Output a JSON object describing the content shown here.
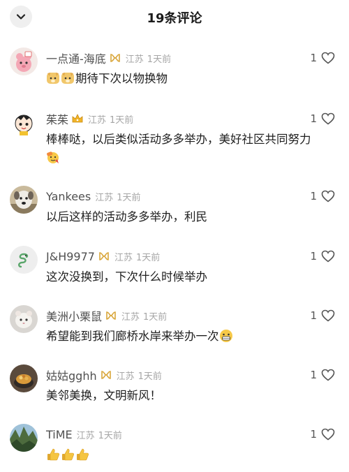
{
  "header": {
    "title": "19条评论",
    "collapse_icon": "chevron-down-icon"
  },
  "comments": [
    {
      "username": "一点通-海底",
      "badge": "gold-ribbon-icon",
      "location": "江苏",
      "time": "1天前",
      "text": "期待下次以物换物",
      "leading_emojis": [
        "doge-emoji",
        "doge-emoji"
      ],
      "trailing_emojis": [],
      "likes": "1"
    },
    {
      "username": "茱茱",
      "badge": "crown-icon",
      "location": "江苏",
      "time": "1天前",
      "text": "棒棒哒，以后类似活动多多举办，美好社区共同努力",
      "leading_emojis": [],
      "trailing_emojis": [
        "salute-face-emoji"
      ],
      "likes": "1"
    },
    {
      "username": "Yankees",
      "badge": "",
      "location": "江苏",
      "time": "1天前",
      "text": "以后这样的活动多多举办，利民",
      "leading_emojis": [],
      "trailing_emojis": [],
      "likes": "1"
    },
    {
      "username": "J&H9977",
      "badge": "gold-ribbon-icon",
      "location": "江苏",
      "time": "1天前",
      "text": "这次没换到，下次什么时候举办",
      "leading_emojis": [],
      "trailing_emojis": [],
      "likes": "1"
    },
    {
      "username": "美洲小栗鼠",
      "badge": "gold-ribbon-icon",
      "location": "江苏",
      "time": "1天前",
      "text": "希望能到我们廊桥水岸来举办一次",
      "leading_emojis": [],
      "trailing_emojis": [
        "grinning-face-emoji"
      ],
      "likes": "1"
    },
    {
      "username": "姑姑gghh",
      "badge": "gold-ribbon-icon",
      "location": "江苏",
      "time": "1天前",
      "text": "美邻美换，文明新风！",
      "leading_emojis": [],
      "trailing_emojis": [],
      "likes": "1"
    },
    {
      "username": "TiME",
      "badge": "",
      "location": "江苏",
      "time": "1天前",
      "text": "",
      "leading_emojis": [
        "thumbs-up-emoji",
        "thumbs-up-emoji",
        "thumbs-up-emoji"
      ],
      "trailing_emojis": [],
      "likes": "1"
    }
  ]
}
